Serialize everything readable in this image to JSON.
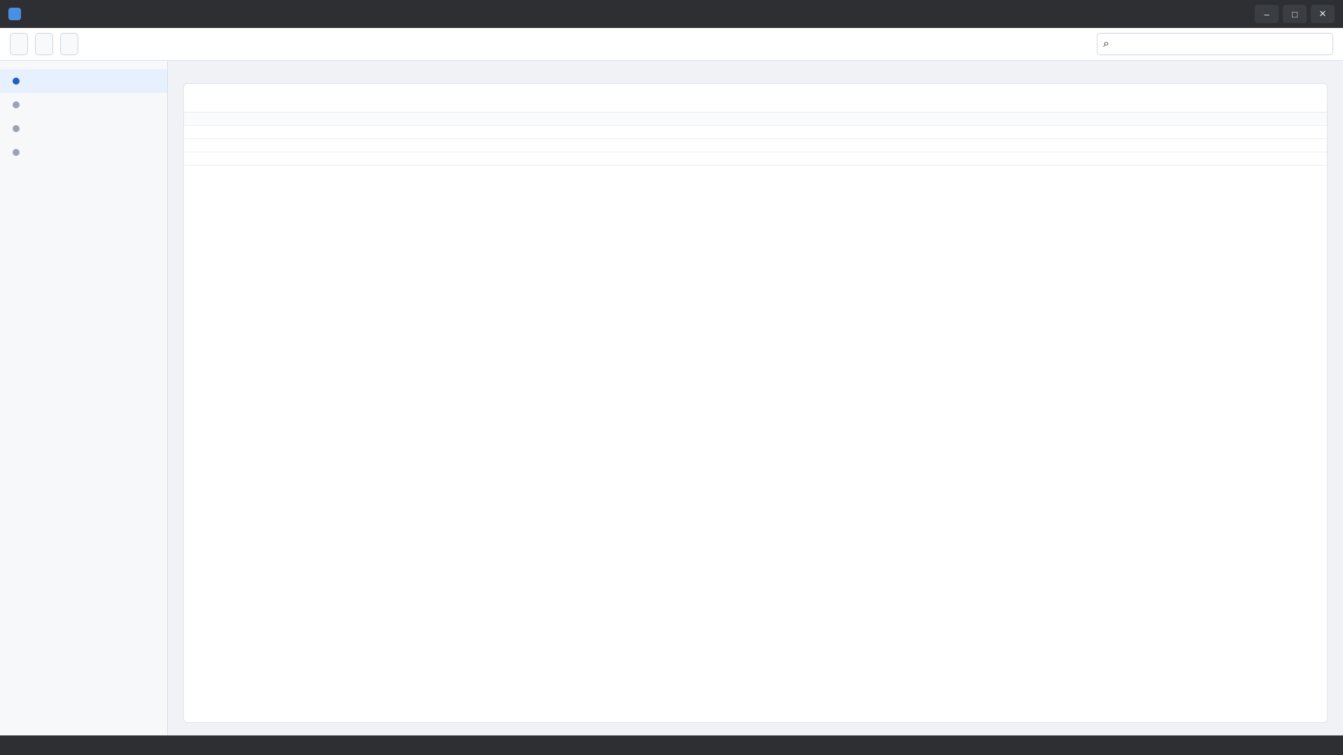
{
  "window": {
    "title": ""
  },
  "toolbar": {
    "button_1": "",
    "button_2": "",
    "button_3": "",
    "search_placeholder": ""
  },
  "sidebar": {
    "items": [
      {
        "label": ""
      },
      {
        "label": ""
      },
      {
        "label": ""
      },
      {
        "label": ""
      }
    ]
  },
  "main": {
    "title": "",
    "panel_title": "",
    "columns": [
      "",
      "",
      "",
      ""
    ],
    "rows": [
      [
        "",
        "",
        "",
        ""
      ],
      [
        "",
        "",
        "",
        ""
      ],
      [
        "",
        "",
        "",
        ""
      ]
    ]
  },
  "status": {
    "text": ""
  }
}
